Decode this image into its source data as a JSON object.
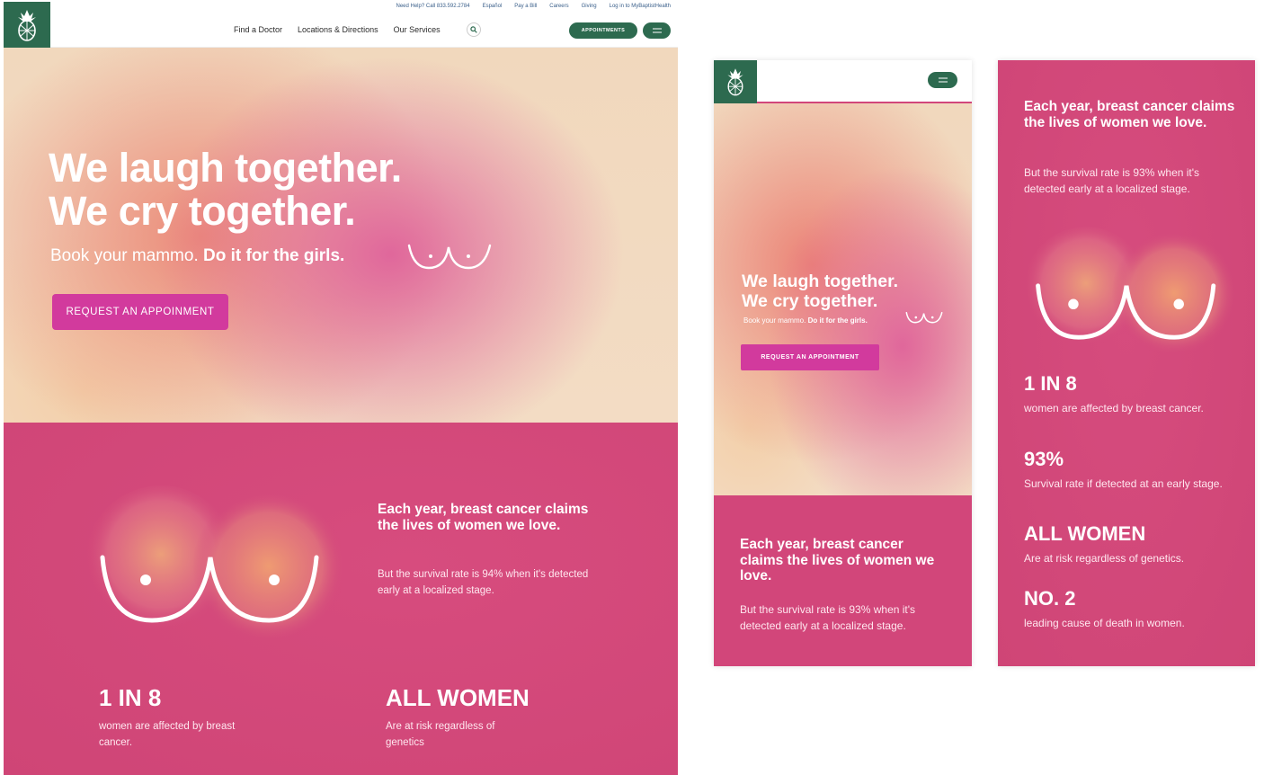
{
  "colors": {
    "brand_green": "#2d6a4f",
    "accent_magenta": "#d23a9d",
    "section_pink": "#d2467a"
  },
  "utility_nav": [
    "Need Help? Call 833.592.2784",
    "Español",
    "Pay a Bill",
    "Careers",
    "Giving",
    "Log in to MyBaptistHealth"
  ],
  "main_nav": [
    "Find a Doctor",
    "Locations & Directions",
    "Our Services"
  ],
  "appointments_label": "APPOINTMENTS",
  "icons": {
    "logo": "pineapple-logo",
    "search": "search-icon",
    "menu": "hamburger-icon"
  },
  "hero": {
    "line1": "We laugh together.",
    "line2": "We cry together.",
    "subtitle_plain": "Book your mammo.",
    "subtitle_bold": "Do it for the girls.",
    "cta_desktop": "REQUEST AN APPOINMENT",
    "cta_mobile": "REQUEST AN APPOINTMENT"
  },
  "stats_section": {
    "claim": "Each year, breast cancer claims the lives of women we love.",
    "survival_desktop": "But the survival rate is 94% when it's detected early at a localized stage.",
    "survival_mobile": "But the survival rate is 93% when it's detected early at a localized stage.",
    "stats": [
      {
        "value": "1 IN 8",
        "label": "women are affected by breast cancer."
      },
      {
        "value": "93%",
        "label": "Survival rate if detected at an early stage."
      },
      {
        "value": "ALL WOMEN",
        "label": "Are at risk regardless of genetics.",
        "label_desktop": "Are at risk regardless of genetics"
      },
      {
        "value": "NO. 2",
        "label": "leading cause of death in women."
      }
    ]
  }
}
